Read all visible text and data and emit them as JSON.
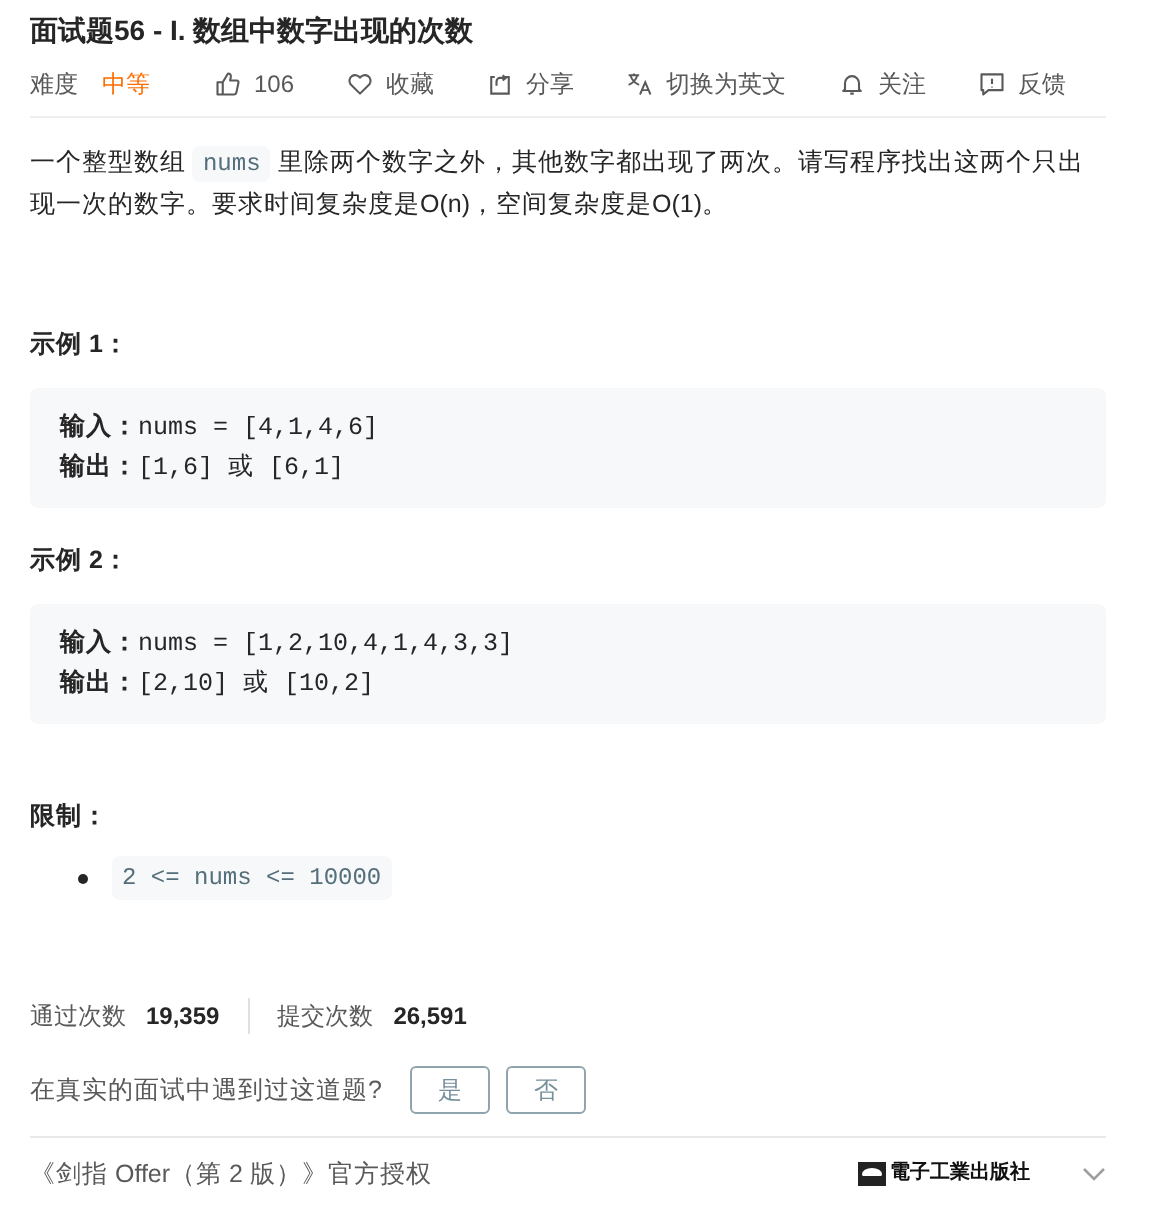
{
  "title": "面试题56 - I. 数组中数字出现的次数",
  "meta": {
    "difficulty_label": "难度",
    "difficulty": "中等",
    "actions": [
      {
        "kind": "like",
        "label": "106"
      },
      {
        "kind": "favorite",
        "label": "收藏"
      },
      {
        "kind": "share",
        "label": "分享"
      },
      {
        "kind": "translate",
        "label": "切换为英文"
      },
      {
        "kind": "follow",
        "label": "关注"
      },
      {
        "kind": "feedback",
        "label": "反馈"
      }
    ]
  },
  "description": [
    {
      "kind": "text",
      "text": "一个整型数组 "
    },
    {
      "kind": "code",
      "text": "nums"
    },
    {
      "kind": "text",
      "text": " 里除两个数字之外，其他数字都出现了两次。请写程序找出这两个只出现一次的数字。要求时间复杂度是O(n)，空间复杂度是O(1)。"
    }
  ],
  "examples": [
    {
      "heading": "示例 1：",
      "lines": [
        {
          "label": "输入：",
          "text": "nums = [4,1,4,6]"
        },
        {
          "label": "输出：",
          "text": "[1,6] 或 [6,1]"
        }
      ]
    },
    {
      "heading": "示例 2：",
      "lines": [
        {
          "label": "输入：",
          "text": "nums = [1,2,10,4,1,4,3,3]"
        },
        {
          "label": "输出：",
          "text": "[2,10] 或 [10,2]"
        }
      ]
    }
  ],
  "constraints": {
    "heading": "限制：",
    "items": [
      "2 <= nums <= 10000"
    ]
  },
  "stats": [
    {
      "label": "通过次数",
      "value": "19,359"
    },
    {
      "label": "提交次数",
      "value": "26,591"
    }
  ],
  "interview": {
    "question": "在真实的面试中遇到过这道题?",
    "buttons": [
      "是",
      "否"
    ]
  },
  "footer": {
    "text": "《剑指 Offer（第 2 版）》官方授权",
    "publisher": "電子工業出版社"
  }
}
